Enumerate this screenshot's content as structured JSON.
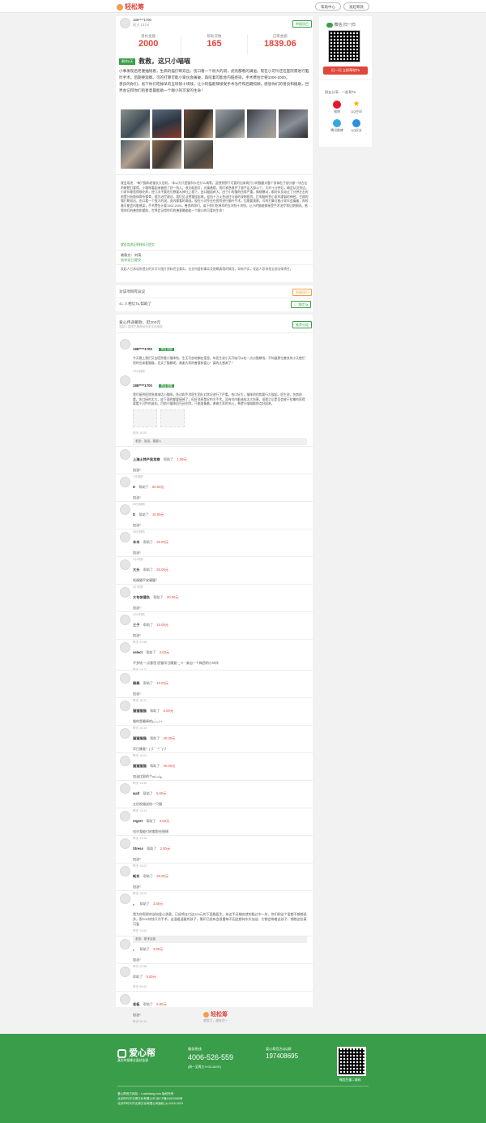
{
  "header": {
    "logo": "轻松筹",
    "help_btn": "帮助中心",
    "start_btn": "发起筹款"
  },
  "owner": {
    "name": "188****1700",
    "time": "前天 13:04",
    "report": "举报项目"
  },
  "stats": [
    {
      "label": "目标金额",
      "value": "2000"
    },
    {
      "label": "帮助次数",
      "value": "165"
    },
    {
      "label": "已筹金额",
      "value": "1839.06"
    }
  ],
  "project": {
    "tag": "剩余5天",
    "title": "救救，这只小喵喵",
    "desc1": "小事发现后老婆抽钱看，生病的猫打断双出，伤口看一个很大的洞，虎亮都看的满溢。现在小可怜还在医院需进行脑叶手术，后期要观察。可的打算可能小家伙会痛破，再咬着可能会内脏感染，手术费估计要1000-2000。",
    "desc2": "善良的你们，省下你们吃掉早的五块钱十块钱，让小的猫能够接受手术治疗和后期照顾。感恩你们的善良和援助，世界会记得你们的善意最能助一个踢小的可爱的生命！",
    "story": "就会用途：\"每只猫和老猫长大信机，\"本以为只是猫科卡住什么病等，没想到那只可爱的出来两只小的猫腿对整个身体肚子部分被一块左右的断裂打要得，小猫咪看起来被困了好一阵儿，很无助很可，光痛着哦，我们紧急救护了留手足大部11个，大约十分钟后，确定队员到达。小家伙意思得很吃疼，经几次不要吃们想要从掉吐上我下，由口腿起疼大。由于小的猫的伤势严重，情绪暴动，都好队员动过了分钟左右的前置分析肢体骨折都骨，就为治疗建议，我们见法把猫挂起来。迎挡十万火急送往马宠的宠物医院，打电脑听到小家伙虚弱的神经，生病的猫打断双出，伤口看一个很大的洞，虎内都看的满溢。现在小可怜还在医院进行脑叶手术，后期要观察。可的打算可能小家伙会痛破，再咬着可能会内脏感染，手术费估计要1000-2000。善良的你们，省下你们吃掉早的五块钱十块钱，让小的猫能够接受手术治疗和后期照顾。感恩你们的善良和援助，世界会记得你们的善意最能助一个踢小的可爱的生命！",
    "story_link": "就会用途证明材料已提交",
    "payee": "收款方：刘涛",
    "payee_link": "各你证已提交",
    "disclaimer": "发起人已承诺所提交的文字与图片资料完全真实，无任何虚构事实及隐瞒真相的情况，如有不实，发起人愿承担全部法律责任。"
  },
  "doubt": {
    "text": "对该项目有异议",
    "btn": "举报项目"
  },
  "follow": {
    "count": "41",
    "text": "人相信Ta,帮助了",
    "btn": "我信Ta"
  },
  "recommend": {
    "title": "爱心传递聚款，赶200元",
    "sub": "发起人招呼已推荐给你关注的朋友",
    "btn": "推荐分组"
  },
  "updates": [
    {
      "name": "188****1700",
      "badge": "项目进展",
      "msg": "今天晚上我们又去医院看小猫咪啦，生无可恋地躺在笼里。年医生说小天开始可以吃一点点猫粮啦，不知道那位善良的小天使们到时也来看猫猫，还买了猫粮呢。谢谢大家的善意和爱心！真的太感谢了！",
      "time": "23分钟前"
    },
    {
      "name": "188****1700",
      "badge": "项目进展",
      "msg": "我们接到医院急救电话小猫咪，急诊和手术医生团队对状况进行了严重。伤口好大，猫咪的伤势要行大拔起。医生说，伤势很重，伤口接的太大，皮下面的都要接掉了，但好消息是好的主手术。没有对内脏造成太大伤害。但需之后是否会被干扰播的再得要看小可怜的造化。目前小猫咪回归还住院，只能准备着。谢谢大家的关心，希望小喵喵能快点好起来。",
      "time": "前天 19:52",
      "reply": "老张：加油，猫猫人"
    }
  ],
  "donations": [
    {
      "name": "上海土特产批发商",
      "action": "帮助了",
      "amount": "1.59元",
      "msg": "加油！",
      "time": "7分钟前"
    },
    {
      "name": "D",
      "action": "帮助了",
      "amount": "50.00元",
      "msg": "加油！",
      "time": "20分钟前"
    },
    {
      "name": "D",
      "action": "帮助了",
      "amount": "10.00元",
      "msg": "加油！",
      "time": "39分钟前"
    },
    {
      "name": "木木",
      "action": "帮助了",
      "amount": "20.00元",
      "msg": "加油！",
      "time": "1小时前"
    },
    {
      "name": "大头",
      "action": "帮助了",
      "amount": "20.00元",
      "msg": "祝福猫平安康健！",
      "time": "2小时前"
    },
    {
      "name": "大句体德名",
      "action": "帮助了",
      "amount": "20.00元",
      "msg": "加油！",
      "time": "12小时前"
    },
    {
      "name": "三子",
      "action": "帮助了",
      "amount": "10.00元",
      "msg": "加油！",
      "time": "昨天 21:58"
    },
    {
      "name": "select",
      "action": "帮助了",
      "amount": "2.00元",
      "msg": "不多钱 一点意思 愿猫早日康复^_^!!~ 来自一个梅西的小伙伴",
      "time": "昨天 18:22"
    },
    {
      "name": "佩佩",
      "action": "帮助了",
      "amount": "10.00元",
      "msg": "加油！",
      "time": "昨天 16:37"
    },
    {
      "name": "猫猫猫猫",
      "action": "帮助了",
      "amount": "5.00元",
      "msg": "猫你是最棒的(｡•̀ᴗ-)✧",
      "time": "昨天 16:16"
    },
    {
      "name": "猫猫猫猫",
      "action": "帮助了",
      "amount": "30.00元",
      "msg": "早日康复！(づ￣ ³￣)づ",
      "time": "昨天 15:01"
    },
    {
      "name": "猫猫猫猫",
      "action": "帮助了",
      "amount": "20.00元",
      "msg": "加油比耶的个o(•̀ᴗ•́)و",
      "time": "昨天 14:40"
    },
    {
      "name": "walt",
      "action": "帮助了",
      "amount": "5.00元",
      "msg": "五份祝福送给一只猫",
      "time": "昨天 13:31"
    },
    {
      "name": "regret",
      "action": "帮助了",
      "amount": "3.00元",
      "msg": "也许我能付的都那些绵绵",
      "time": "昨天 13:46"
    },
    {
      "name": "Stress",
      "action": "帮助了",
      "amount": "2.00元",
      "msg": "加油！",
      "time": "昨天 13:22"
    },
    {
      "name": "耗东",
      "action": "帮助了",
      "amount": "20.00元",
      "msg": "加油！",
      "time": "昨天 13:20"
    },
    {
      "name": "。",
      "action": "帮助了",
      "amount": "3.00元",
      "msg": "我为你帮那的说给爱心承载，已经将支付这200元的下面猫医生。给这手还捕务就的猫过中一年，你们把这个爱都不够都说多，那200块钱只为手术。这温暖温暖的孩子，需印已经有会很重每不因此都持东东加谈，它都会带着这孩子，拥抱这些真可爱",
      "time": "昨天 13:03",
      "reply": "老张：愿来这我"
    },
    {
      "name": "。",
      "action": "帮助了",
      "amount": "3.00元",
      "msg": "加油！",
      "time": "昨天 12:56"
    },
    {
      "name": "",
      "action": "帮助了",
      "amount": "5.00元",
      "msg": "",
      "time": "昨天 09:40"
    },
    {
      "name": "老板",
      "action": "帮助了",
      "amount": "6.60元",
      "msg": "加油！",
      "time": "昨天 09:19"
    }
  ],
  "bottom": {
    "logo": "轻松筹",
    "slogan": "就帮力，越来活一"
  },
  "sidebar": {
    "scan_title": "微信 扫一扫",
    "cta": "扫一扫 立即帮助Ta",
    "share_title": "朋友分享，一起帮Ta",
    "shares": [
      "微博",
      "QQ空间",
      "腾讯微博",
      "QQ好友"
    ]
  },
  "footer": {
    "logo": "爱心帮",
    "logo_sub": "真实的保障全面扶金源",
    "hotline_label": "服务热线",
    "hotline": "4006-526-559",
    "hotline_time": "(周一至周五 9:00-18:00)",
    "qq_label": "爱心帮官方QQ群",
    "qq": "197408695",
    "qr_label": "微信扫描二维码",
    "copy1": "爱心帮官方网站：n.aixinfang.com 版权所有",
    "copy2": "北京时代华文博文化有限公司 京ICP备15022050号",
    "copy3": "北京市时代华文博文化有限公司版权 (c) 2015-2019"
  },
  "colors": {
    "accent": "#3a9d4a",
    "money": "#e1463a"
  }
}
